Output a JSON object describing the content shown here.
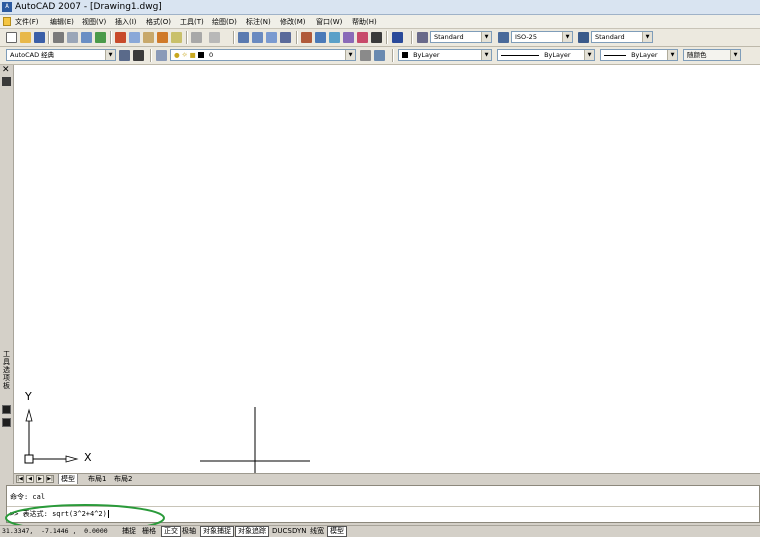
{
  "titlebar": {
    "title": "AutoCAD 2007 - [Drawing1.dwg]",
    "icon": "autocad-logo"
  },
  "menus": [
    {
      "label": "文件(F)"
    },
    {
      "label": "编辑(E)"
    },
    {
      "label": "视图(V)"
    },
    {
      "label": "插入(I)"
    },
    {
      "label": "格式(O)"
    },
    {
      "label": "工具(T)"
    },
    {
      "label": "绘图(D)"
    },
    {
      "label": "标注(N)"
    },
    {
      "label": "修改(M)"
    },
    {
      "label": "窗口(W)"
    },
    {
      "label": "帮助(H)"
    }
  ],
  "toolbar1": {
    "text_style": "Standard",
    "dim_style": "ISO-25",
    "table_style": "Standard"
  },
  "toolbar2": {
    "workspace": "AutoCAD 经典",
    "layer": "0",
    "color": "ByLayer",
    "linetype": "ByLayer",
    "lineweight": "ByLayer",
    "plotstyle": "随颜色"
  },
  "left_palette": {
    "label": "工具选项板"
  },
  "ucs": {
    "y_label": "Y",
    "x_label": "X"
  },
  "tabs": [
    {
      "label": "模型",
      "active": true
    },
    {
      "label": "布局1",
      "active": false
    },
    {
      "label": "布局2",
      "active": false
    }
  ],
  "command": {
    "history": "命令: cal",
    "prompt": ">> 表达式: sqrt(3^2+4^2)"
  },
  "status": {
    "coordinates": "31.3347,  -7.1446 ,  0.0000",
    "buttons": [
      {
        "label": "捕捉",
        "on": false
      },
      {
        "label": "栅格",
        "on": false
      },
      {
        "label": "正交",
        "on": true
      },
      {
        "label": "极轴",
        "on": false
      },
      {
        "label": "对象捕捉",
        "on": true
      },
      {
        "label": "对象追踪",
        "on": true
      },
      {
        "label": "DUCS",
        "on": false
      },
      {
        "label": "DYN",
        "on": false
      },
      {
        "label": "线宽",
        "on": false
      },
      {
        "label": "模型",
        "on": true
      }
    ]
  },
  "colors": {
    "annotation": "#2a9a3a",
    "canvas": "#ffffff"
  }
}
